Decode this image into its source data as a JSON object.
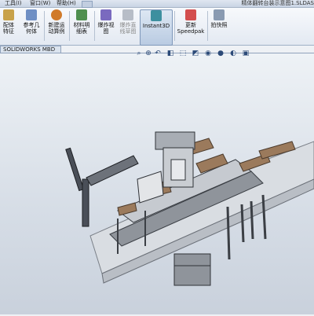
{
  "menu": {
    "tools": "工具(I)",
    "window": "窗口(W)",
    "help": "帮助(H)"
  },
  "document_title": "精体翻转台装示意图1.SLDAS",
  "ribbon": {
    "btn1": "配体\n特征",
    "btn2": "参考几\n何体",
    "btn3": "新建运\n动算例",
    "btn4": "材料明\n细表",
    "btn5": "爆炸视\n图",
    "btn6": "爆炸直\n线草图",
    "btn7": "Instant3D",
    "btn8": "更新\nSpeedpak",
    "btn9": "拍快照"
  },
  "tab_label": "SOLIDWORKS MBD",
  "icons": {
    "heads_up": [
      "zoom-to-fit-icon",
      "zoom-area-icon",
      "previous-view-icon",
      "section-view-icon",
      "view-orientation-icon",
      "display-style-icon",
      "hide-show-icon",
      "appearance-icon",
      "scene-icon",
      "view-settings-icon"
    ]
  },
  "colors": {
    "ribbon_bg": "#e3e9f2",
    "viewport_top": "#eef2f6",
    "viewport_bottom": "#c9d1dc",
    "frame": "#4a4f58",
    "wood": "#9b7a5c",
    "base": "#d9dde2"
  }
}
